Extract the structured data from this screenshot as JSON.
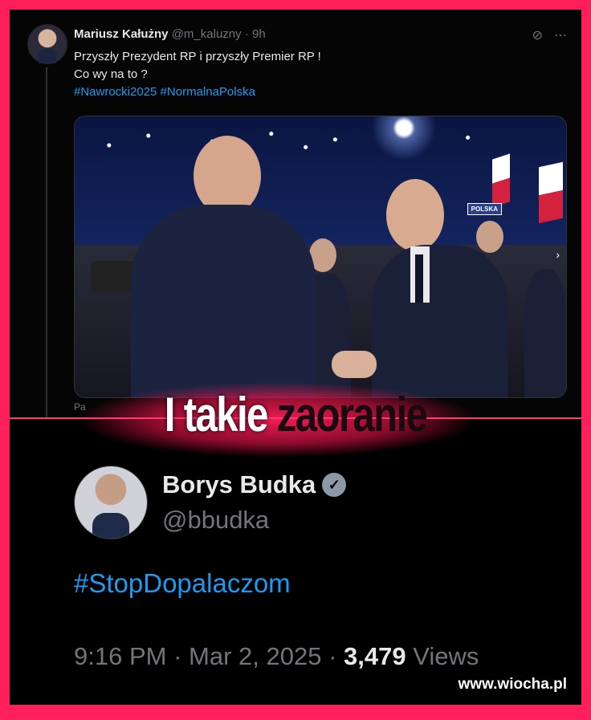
{
  "tweet1": {
    "name": "Mariusz Kałużny",
    "handle": "@m_kaluzny",
    "separator": "·",
    "time": "9h",
    "line1": "Przyszły Prezydent RP i przyszły Premier RP !",
    "line2": "Co wy na to ?",
    "hashtags": "#Nawrocki2025 #NormalnaPolska",
    "photo_sign": "POLSKA",
    "peek_text": "Pa"
  },
  "banner": {
    "part1": "I takie",
    "part2": "zaoranie"
  },
  "tweet2": {
    "name": "Borys Budka",
    "handle": "@bbudka",
    "hashtag": "#StopDopalaczom",
    "time": "9:16 PM",
    "sep": "·",
    "date": "Mar 2, 2025",
    "views_count": "3,479",
    "views_label": "Views"
  },
  "watermark": "www.wiocha.pl",
  "colors": {
    "frame": "#ff1f5a",
    "link": "#1d9bf0",
    "text": "#e7e9ea",
    "muted": "#71767b"
  }
}
